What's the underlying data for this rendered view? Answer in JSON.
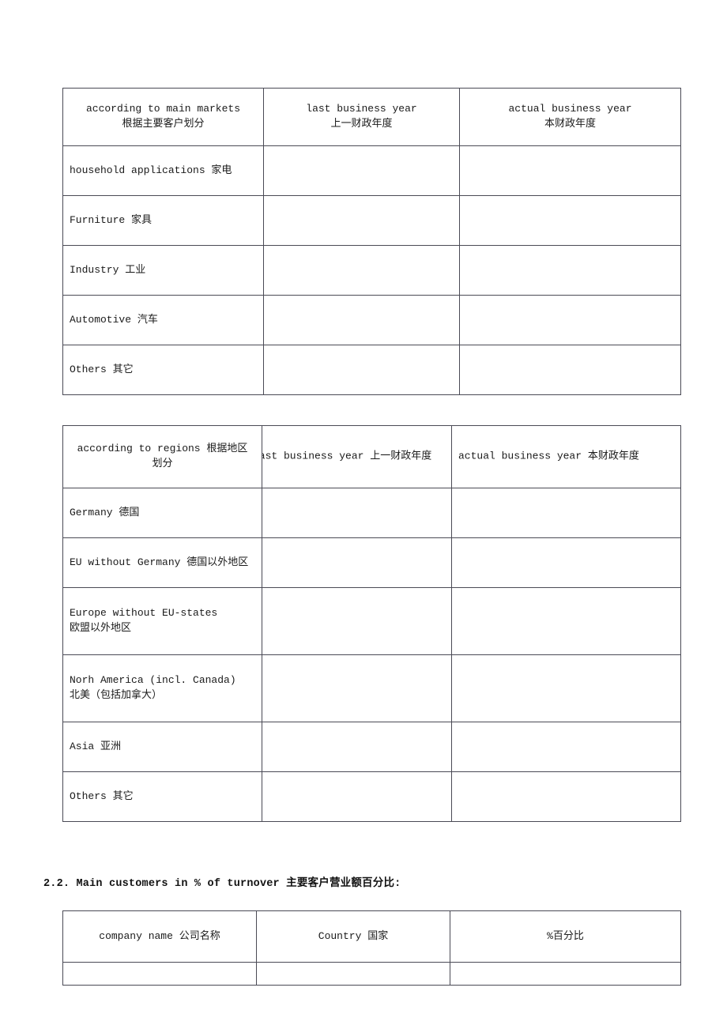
{
  "document": {
    "language_note": "bilingual English / Chinese supplier questionnaire form",
    "heading_2_2": "2.2. Main customers in % of turnover 主要客户营业额百分比:"
  },
  "tables": {
    "main_markets": {
      "headers": [
        {
          "en": "according to main markets",
          "zh": "根据主要客户划分"
        },
        {
          "en": "last business year",
          "zh": "上一财政年度"
        },
        {
          "en": "actual business year",
          "zh": "本财政年度"
        }
      ],
      "rows": [
        {
          "label": "household applications 家电",
          "last_business_year": "",
          "actual_business_year": ""
        },
        {
          "label": "Furniture 家具",
          "last_business_year": "",
          "actual_business_year": ""
        },
        {
          "label": "Industry 工业",
          "last_business_year": "",
          "actual_business_year": ""
        },
        {
          "label": "Automotive 汽车",
          "last_business_year": "",
          "actual_business_year": ""
        },
        {
          "label": "Others 其它",
          "last_business_year": "",
          "actual_business_year": ""
        }
      ]
    },
    "regions": {
      "headers": [
        {
          "line1": "according to regions 根据地区",
          "line2": "划分"
        },
        {
          "text": "last business year 上一财政年度"
        },
        {
          "text": "actual business year 本财政年度"
        }
      ],
      "rows": [
        {
          "label_line1": "Germany 德国",
          "label_line2": "",
          "last_business_year": "",
          "actual_business_year": ""
        },
        {
          "label_line1": "EU without Germany 德国以外地区",
          "label_line2": "",
          "last_business_year": "",
          "actual_business_year": ""
        },
        {
          "label_line1": "Europe without EU-states",
          "label_line2": "欧盟以外地区",
          "last_business_year": "",
          "actual_business_year": ""
        },
        {
          "label_line1": "Norh America (incl. Canada)",
          "label_line2": "北美（包括加拿大）",
          "last_business_year": "",
          "actual_business_year": ""
        },
        {
          "label_line1": "Asia 亚洲",
          "label_line2": "",
          "last_business_year": "",
          "actual_business_year": ""
        },
        {
          "label_line1": "Others 其它",
          "label_line2": "",
          "last_business_year": "",
          "actual_business_year": ""
        }
      ]
    },
    "main_customers": {
      "headers": [
        "company name 公司名称",
        "Country 国家",
        "%百分比"
      ],
      "rows": [
        {
          "company_name": "",
          "country": "",
          "percent": ""
        }
      ]
    }
  },
  "colors": {
    "page_background": "#ffffff",
    "table_border": "#4a4a55",
    "text": "#1a1a1a"
  }
}
